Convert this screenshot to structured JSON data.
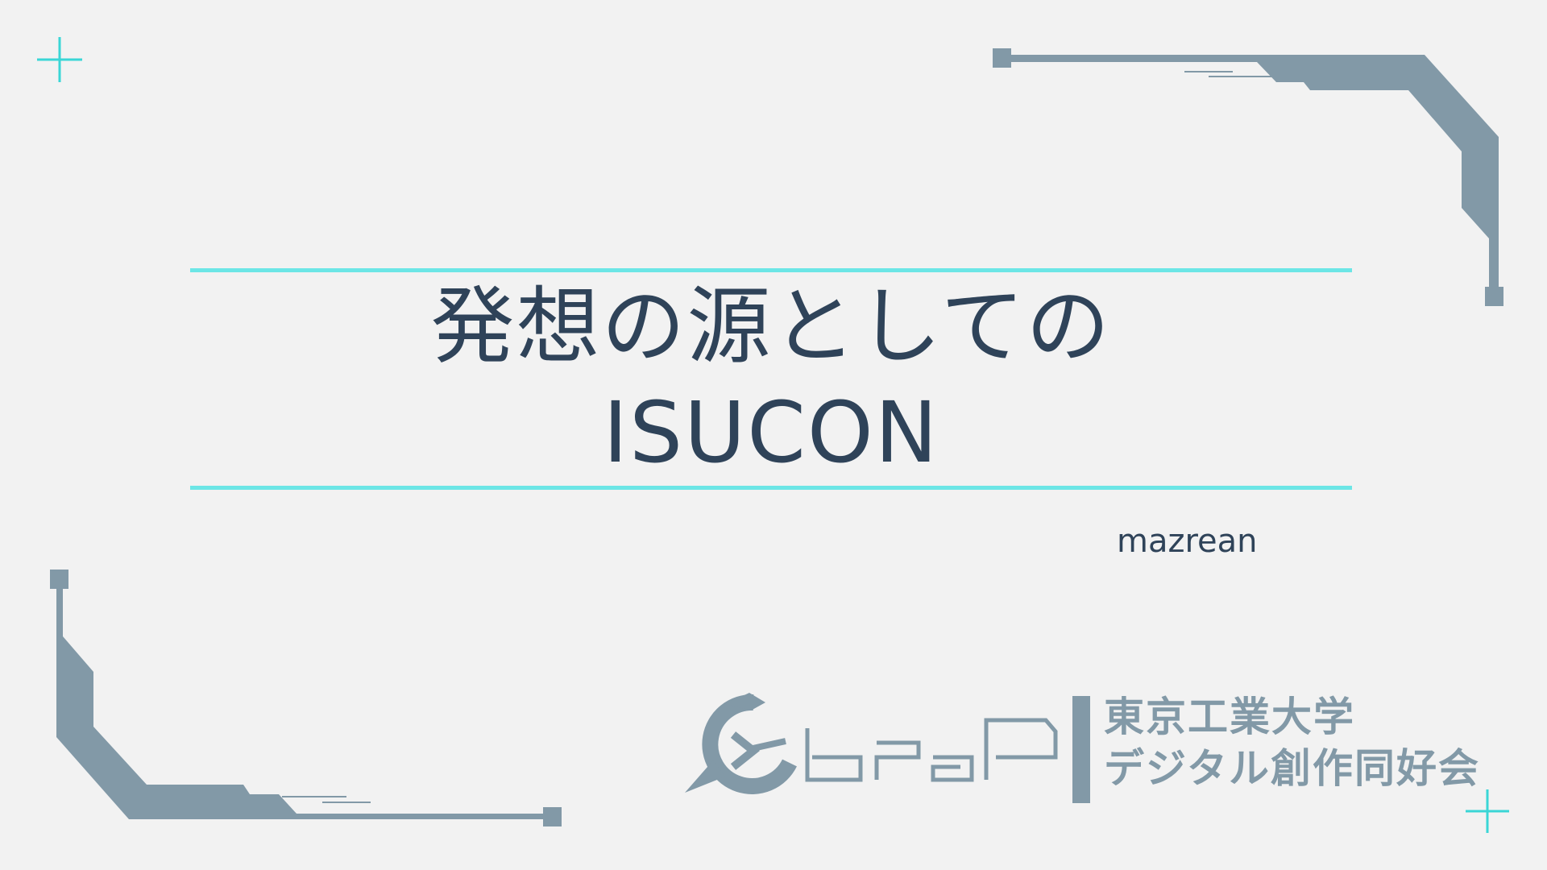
{
  "slide": {
    "title_line1": "発想の源としての",
    "title_line2": "ISUCON",
    "author": "mazrean"
  },
  "logo": {
    "org_line1": "東京工業大学",
    "org_line2": "デジタル創作同好会"
  },
  "colors": {
    "background": "#f2f2f2",
    "accent": "#6ce6e6",
    "title_text": "#2f4359",
    "decor": "#8299a7"
  },
  "icons": [
    "plus-icon",
    "traP-logo-icon"
  ]
}
